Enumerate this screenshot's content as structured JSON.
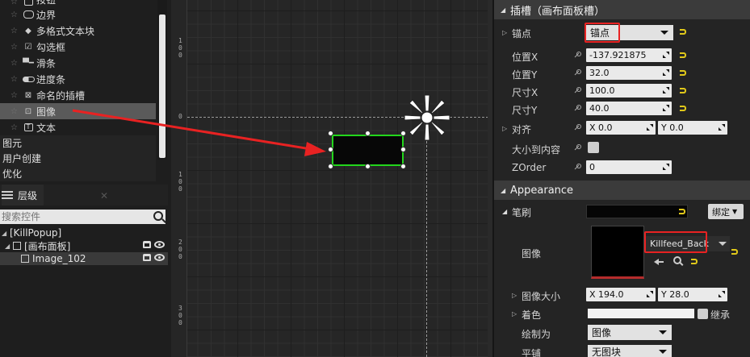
{
  "palette": {
    "items": [
      {
        "label": "按钮",
        "icon": "button-icon"
      },
      {
        "label": "边界",
        "icon": "border-icon"
      },
      {
        "label": "多格式文本块",
        "icon": "diamond-icon"
      },
      {
        "label": "勾选框",
        "icon": "checkbox-icon"
      },
      {
        "label": "滑条",
        "icon": "slider-icon"
      },
      {
        "label": "进度条",
        "icon": "progressbar-icon"
      },
      {
        "label": "命名的插槽",
        "icon": "named-slot-icon"
      },
      {
        "label": "图像",
        "icon": "image-icon"
      },
      {
        "label": "文本",
        "icon": "text-icon"
      }
    ],
    "categories": [
      "图元",
      "用户创建",
      "优化"
    ]
  },
  "hierarchy": {
    "tab_label": "层级",
    "search_placeholder": "搜索控件",
    "tree": [
      {
        "label": "[KillPopup]"
      },
      {
        "label": "[画布面板]"
      },
      {
        "label": "Image_102"
      }
    ]
  },
  "canvas": {
    "ruler_labels": [
      "1\n0\n0",
      "0",
      "1\n0\n0",
      "2\n0\n0",
      "3\n0\n0"
    ]
  },
  "details": {
    "slot_header": "插槽（画布面板槽）",
    "anchor_label": "锚点",
    "anchor_value": "锚点",
    "pos_x_label": "位置X",
    "pos_x_value": "-137.921875",
    "pos_y_label": "位置Y",
    "pos_y_value": "32.0",
    "size_x_label": "尺寸X",
    "size_x_value": "100.0",
    "size_y_label": "尺寸Y",
    "size_y_value": "40.0",
    "align_label": "对齐",
    "align_x": "X  0.0",
    "align_y": "Y  0.0",
    "size_to_content_label": "大小到内容",
    "zorder_label": "ZOrder",
    "zorder_value": "0",
    "appearance_header": "Appearance",
    "brush_label": "笔刷",
    "bind_label": "绑定",
    "image_label": "图像",
    "image_asset": "Killfeed_Back",
    "image_size_label": "图像大小",
    "image_size_x": "X  194.0",
    "image_size_y": "Y  28.0",
    "tint_label": "着色",
    "inherit_label": "继承",
    "draw_as_label": "绘制为",
    "draw_as_value": "图像",
    "tiling_label": "平铺",
    "tiling_value": "无图块"
  },
  "colors": {
    "selection_outline": "#23d61c",
    "annotation_red": "#e82222",
    "reset_yellow": "#e0c81a"
  }
}
